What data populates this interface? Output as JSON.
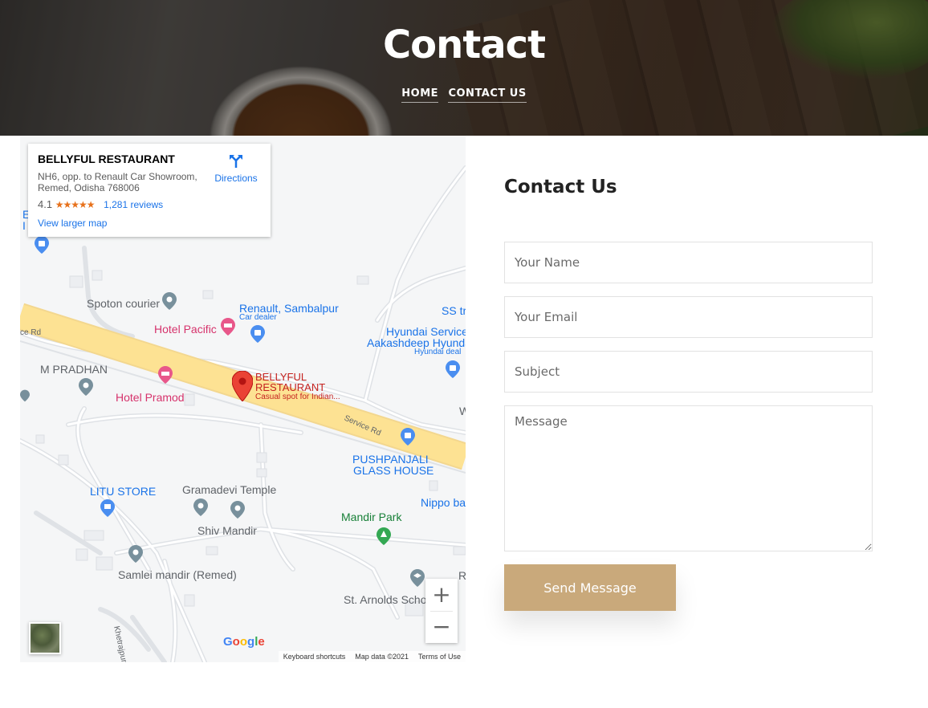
{
  "hero": {
    "title": "Contact",
    "breadcrumb": [
      "HOME",
      "CONTACT US"
    ]
  },
  "map": {
    "card": {
      "name": "BELLYFUL RESTAURANT",
      "address": "NH6, opp. to Renault Car Showroom, Remed, Odisha 768006",
      "rating": "4.1",
      "stars": "★★★★★",
      "reviews": "1,281 reviews",
      "directions_label": "Directions",
      "larger_map": "View larger map"
    },
    "places": {
      "spoton": "Spoton courier",
      "renault": "Renault, Sambalpur",
      "renault_sub": "Car dealer",
      "ss": "SS tr",
      "hotel_pacific": "Hotel Pacific",
      "hyundai": "Hyundai Service",
      "aakashdeep": "Aakashdeep Hyunda",
      "hyundai_sub": "Hyundai deal",
      "m_pradhan": "M PRADHAN",
      "hotel_pramod": "Hotel Pramod",
      "bellyful_line1": "BELLYFUL",
      "bellyful_line2": "RESTAURANT",
      "bellyful_sub": "Casual spot for Indian...",
      "pushpanjali1": "PUSHPANJALI",
      "pushpanjali2": "GLASS HOUSE",
      "litu": "LITU STORE",
      "gramadevi": "Gramadevi Temple",
      "shiv": "Shiv Mandir",
      "mandir_park": "Mandir Park",
      "nippo": "Nippo ba",
      "samlei": "Samlei mandir (Remed)",
      "st_arnolds": "St. Arnolds Scho",
      "road_ce": "ce Rd",
      "service_rd": "Service Rd",
      "khetrajpur": "Khetrajpur-Remo",
      "edge_e": "E",
      "edge_i": "I",
      "edge_w": "W",
      "edge_r": "R"
    },
    "zoom_in": "+",
    "zoom_out": "−",
    "google": [
      "G",
      "o",
      "o",
      "g",
      "l",
      "e"
    ],
    "footer": [
      "Keyboard shortcuts",
      "Map data ©2021",
      "Terms of Use"
    ]
  },
  "form": {
    "title": "Contact Us",
    "name_placeholder": "Your Name",
    "email_placeholder": "Your Email",
    "subject_placeholder": "Subject",
    "message_placeholder": "Message",
    "send_label": "Send Message"
  },
  "colors": {
    "accent": "#c9a97b",
    "map_link": "#1a73e8",
    "hotel_pink": "#d6336c",
    "park_green": "#188038",
    "pin_red": "#ea4335",
    "road_yellow": "#fde293"
  }
}
